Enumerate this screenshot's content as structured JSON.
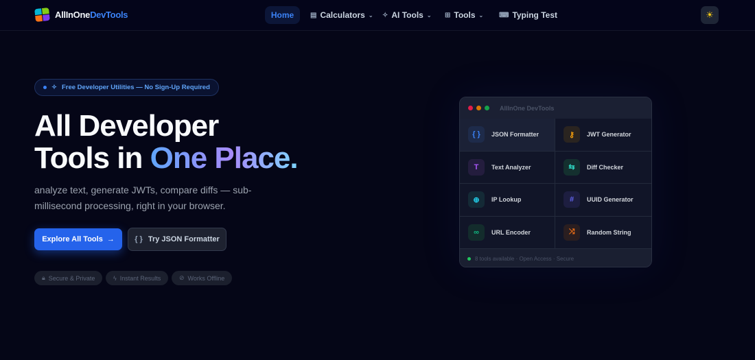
{
  "nav": {
    "logo_a": "AllInOne",
    "logo_b": "DevTools",
    "items": [
      {
        "label": "Home",
        "icon": "home"
      },
      {
        "label": "Calculators",
        "icon": "calculator-icon",
        "dropdown": true
      },
      {
        "label": "AI Tools",
        "icon": "sparkles-icon",
        "dropdown": true
      },
      {
        "label": "Tools",
        "icon": "grid-icon",
        "dropdown": true
      },
      {
        "label": "Typing Test",
        "icon": "keyboard-icon"
      }
    ],
    "theme_icon": "sun-icon"
  },
  "hero": {
    "badge": "Free Developer Utilities — No Sign-Up Required",
    "title_line1": "All Developer",
    "title_line2a": "Tools in ",
    "title_line2b": "One Place.",
    "subtitle": "analyze text, generate JWTs, compare diffs — sub-millisecond processing, right in your browser.",
    "primary_btn": "Explore All Tools",
    "secondary_btn": "Try JSON Formatter",
    "chips": [
      "Secure & Private",
      "Instant Results",
      "Works Offline"
    ]
  },
  "window": {
    "title": "AllInOne DevTools",
    "tools": [
      {
        "label": "JSON Formatter",
        "glyph": "{ }",
        "color": "#3b82f6",
        "bg": "#1e2b4a"
      },
      {
        "label": "JWT Generator",
        "glyph": "⚷",
        "color": "#f59e0b",
        "bg": "#2a2420"
      },
      {
        "label": "Text Analyzer",
        "glyph": "T",
        "color": "#a855f7",
        "bg": "#241d3e"
      },
      {
        "label": "Diff Checker",
        "glyph": "⇆",
        "color": "#2dd4bf",
        "bg": "#14302f"
      },
      {
        "label": "IP Lookup",
        "glyph": "⊕",
        "color": "#22d3ee",
        "bg": "#142a36"
      },
      {
        "label": "UUID Generator",
        "glyph": "#",
        "color": "#6366f1",
        "bg": "#1d1e40"
      },
      {
        "label": "URL Encoder",
        "glyph": "∞",
        "color": "#10b981",
        "bg": "#132c2c"
      },
      {
        "label": "Random String",
        "glyph": "⤨",
        "color": "#f97316",
        "bg": "#2a1e20"
      }
    ],
    "footer": "8 tools available · Open Access · Secure"
  }
}
